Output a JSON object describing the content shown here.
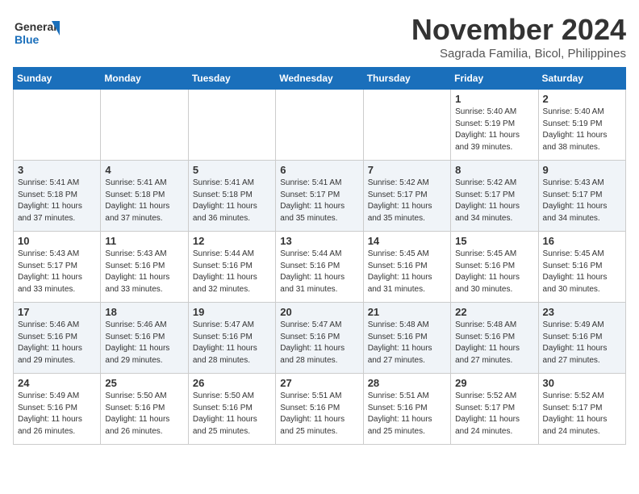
{
  "header": {
    "logo_line1": "General",
    "logo_line2": "Blue",
    "month": "November 2024",
    "location": "Sagrada Familia, Bicol, Philippines"
  },
  "days_of_week": [
    "Sunday",
    "Monday",
    "Tuesday",
    "Wednesday",
    "Thursday",
    "Friday",
    "Saturday"
  ],
  "weeks": [
    [
      {
        "day": "",
        "info": ""
      },
      {
        "day": "",
        "info": ""
      },
      {
        "day": "",
        "info": ""
      },
      {
        "day": "",
        "info": ""
      },
      {
        "day": "",
        "info": ""
      },
      {
        "day": "1",
        "info": "Sunrise: 5:40 AM\nSunset: 5:19 PM\nDaylight: 11 hours\nand 39 minutes."
      },
      {
        "day": "2",
        "info": "Sunrise: 5:40 AM\nSunset: 5:19 PM\nDaylight: 11 hours\nand 38 minutes."
      }
    ],
    [
      {
        "day": "3",
        "info": "Sunrise: 5:41 AM\nSunset: 5:18 PM\nDaylight: 11 hours\nand 37 minutes."
      },
      {
        "day": "4",
        "info": "Sunrise: 5:41 AM\nSunset: 5:18 PM\nDaylight: 11 hours\nand 37 minutes."
      },
      {
        "day": "5",
        "info": "Sunrise: 5:41 AM\nSunset: 5:18 PM\nDaylight: 11 hours\nand 36 minutes."
      },
      {
        "day": "6",
        "info": "Sunrise: 5:41 AM\nSunset: 5:17 PM\nDaylight: 11 hours\nand 35 minutes."
      },
      {
        "day": "7",
        "info": "Sunrise: 5:42 AM\nSunset: 5:17 PM\nDaylight: 11 hours\nand 35 minutes."
      },
      {
        "day": "8",
        "info": "Sunrise: 5:42 AM\nSunset: 5:17 PM\nDaylight: 11 hours\nand 34 minutes."
      },
      {
        "day": "9",
        "info": "Sunrise: 5:43 AM\nSunset: 5:17 PM\nDaylight: 11 hours\nand 34 minutes."
      }
    ],
    [
      {
        "day": "10",
        "info": "Sunrise: 5:43 AM\nSunset: 5:17 PM\nDaylight: 11 hours\nand 33 minutes."
      },
      {
        "day": "11",
        "info": "Sunrise: 5:43 AM\nSunset: 5:16 PM\nDaylight: 11 hours\nand 33 minutes."
      },
      {
        "day": "12",
        "info": "Sunrise: 5:44 AM\nSunset: 5:16 PM\nDaylight: 11 hours\nand 32 minutes."
      },
      {
        "day": "13",
        "info": "Sunrise: 5:44 AM\nSunset: 5:16 PM\nDaylight: 11 hours\nand 31 minutes."
      },
      {
        "day": "14",
        "info": "Sunrise: 5:45 AM\nSunset: 5:16 PM\nDaylight: 11 hours\nand 31 minutes."
      },
      {
        "day": "15",
        "info": "Sunrise: 5:45 AM\nSunset: 5:16 PM\nDaylight: 11 hours\nand 30 minutes."
      },
      {
        "day": "16",
        "info": "Sunrise: 5:45 AM\nSunset: 5:16 PM\nDaylight: 11 hours\nand 30 minutes."
      }
    ],
    [
      {
        "day": "17",
        "info": "Sunrise: 5:46 AM\nSunset: 5:16 PM\nDaylight: 11 hours\nand 29 minutes."
      },
      {
        "day": "18",
        "info": "Sunrise: 5:46 AM\nSunset: 5:16 PM\nDaylight: 11 hours\nand 29 minutes."
      },
      {
        "day": "19",
        "info": "Sunrise: 5:47 AM\nSunset: 5:16 PM\nDaylight: 11 hours\nand 28 minutes."
      },
      {
        "day": "20",
        "info": "Sunrise: 5:47 AM\nSunset: 5:16 PM\nDaylight: 11 hours\nand 28 minutes."
      },
      {
        "day": "21",
        "info": "Sunrise: 5:48 AM\nSunset: 5:16 PM\nDaylight: 11 hours\nand 27 minutes."
      },
      {
        "day": "22",
        "info": "Sunrise: 5:48 AM\nSunset: 5:16 PM\nDaylight: 11 hours\nand 27 minutes."
      },
      {
        "day": "23",
        "info": "Sunrise: 5:49 AM\nSunset: 5:16 PM\nDaylight: 11 hours\nand 27 minutes."
      }
    ],
    [
      {
        "day": "24",
        "info": "Sunrise: 5:49 AM\nSunset: 5:16 PM\nDaylight: 11 hours\nand 26 minutes."
      },
      {
        "day": "25",
        "info": "Sunrise: 5:50 AM\nSunset: 5:16 PM\nDaylight: 11 hours\nand 26 minutes."
      },
      {
        "day": "26",
        "info": "Sunrise: 5:50 AM\nSunset: 5:16 PM\nDaylight: 11 hours\nand 25 minutes."
      },
      {
        "day": "27",
        "info": "Sunrise: 5:51 AM\nSunset: 5:16 PM\nDaylight: 11 hours\nand 25 minutes."
      },
      {
        "day": "28",
        "info": "Sunrise: 5:51 AM\nSunset: 5:16 PM\nDaylight: 11 hours\nand 25 minutes."
      },
      {
        "day": "29",
        "info": "Sunrise: 5:52 AM\nSunset: 5:17 PM\nDaylight: 11 hours\nand 24 minutes."
      },
      {
        "day": "30",
        "info": "Sunrise: 5:52 AM\nSunset: 5:17 PM\nDaylight: 11 hours\nand 24 minutes."
      }
    ]
  ]
}
